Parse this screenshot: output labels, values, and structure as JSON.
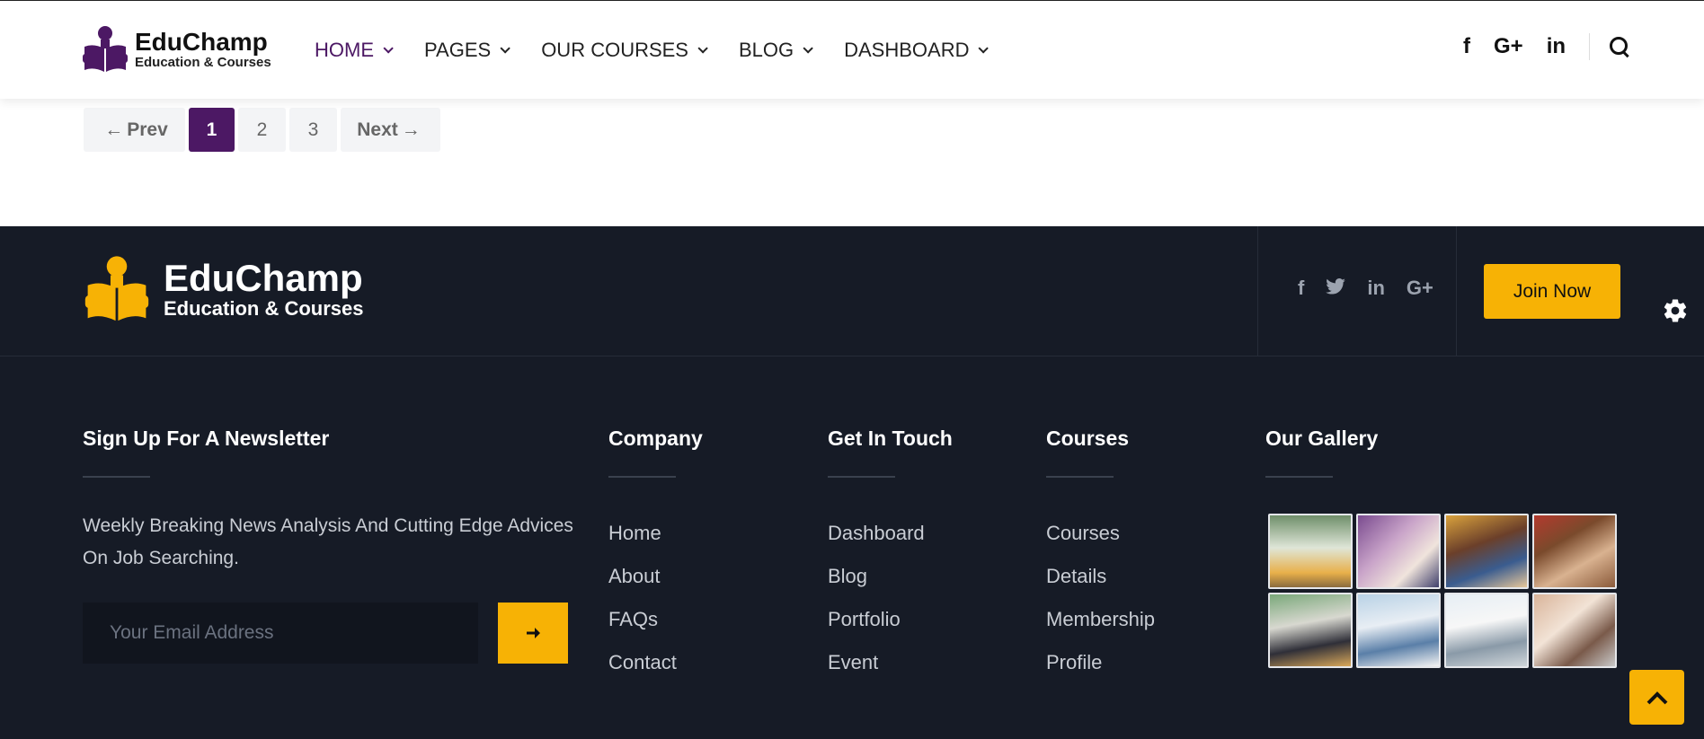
{
  "header": {
    "logo_title": "EduChamp",
    "logo_subtitle": "Education & Courses",
    "nav": [
      {
        "label": "HOME"
      },
      {
        "label": "PAGES"
      },
      {
        "label": "OUR COURSES"
      },
      {
        "label": "BLOG"
      },
      {
        "label": "DASHBOARD"
      }
    ],
    "social": {
      "facebook": "f",
      "google": "G+",
      "linkedin": "in"
    }
  },
  "pagination": {
    "prev_label": "Prev",
    "pages": [
      "1",
      "2",
      "3"
    ],
    "active_page": "1",
    "next_label": "Next"
  },
  "footer": {
    "logo_title": "EduChamp",
    "logo_subtitle": "Education & Courses",
    "social": {
      "facebook": "f",
      "linkedin": "in",
      "google": "G+"
    },
    "join_label": "Join Now",
    "newsletter": {
      "title": "Sign Up For A Newsletter",
      "text": "Weekly Breaking News Analysis And Cutting Edge Advices On Job Searching.",
      "email_placeholder": "Your Email Address"
    },
    "company": {
      "title": "Company",
      "links": [
        "Home",
        "About",
        "FAQs",
        "Contact"
      ]
    },
    "get_in_touch": {
      "title": "Get In Touch",
      "links": [
        "Dashboard",
        "Blog",
        "Portfolio",
        "Event"
      ]
    },
    "courses": {
      "title": "Courses",
      "links": [
        "Courses",
        "Details",
        "Membership",
        "Profile"
      ]
    },
    "gallery": {
      "title": "Our Gallery"
    }
  },
  "colors": {
    "brand_purple": "#4c1864",
    "accent_yellow": "#f7b205",
    "footer_bg": "#161b26"
  }
}
